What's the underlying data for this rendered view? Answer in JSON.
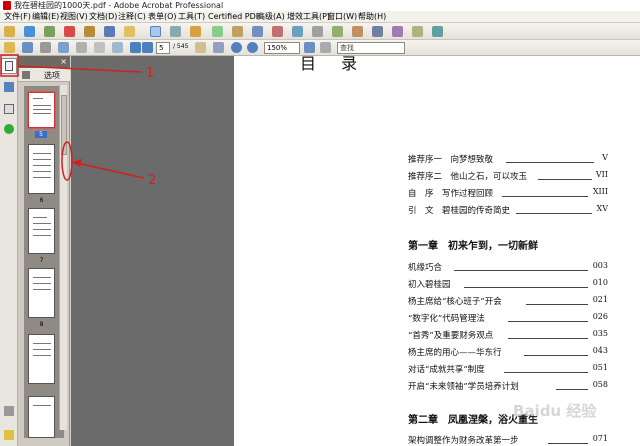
{
  "window": {
    "title": "我在碧桂园的1000天.pdf - Adobe Acrobat Professional"
  },
  "menu": [
    "文件(F)",
    "编辑(E)",
    "视图(V)",
    "文档(D)",
    "注释(C)",
    "表单(O)",
    "工具(T)",
    "Certified PDF",
    "高级(A)",
    "增效工具(P)",
    "窗口(W)",
    "帮助(H)"
  ],
  "toolbar2": {
    "page_current": "5",
    "page_total": "/ 545",
    "zoom": "150%",
    "search_placeholder": "查找"
  },
  "pages_panel": {
    "options_label": "选项",
    "thumb_labels": [
      "5",
      "6",
      "7",
      "8"
    ]
  },
  "annotations": {
    "callout1": "1",
    "callout2": "2"
  },
  "document": {
    "title": "目 录",
    "toc_front": [
      {
        "title": "推荐序一　向梦想致敬",
        "page": "V"
      },
      {
        "title": "推荐序二　他山之石，可以攻玉",
        "page": "VII"
      },
      {
        "title": "自　序　写作过程回顾",
        "page": "XIII"
      },
      {
        "title": "引　文　碧桂园的传奇简史",
        "page": "XV"
      }
    ],
    "chapter1": "第一章　初来乍到，一切新鲜",
    "toc_ch1": [
      {
        "title": "机缘巧合",
        "page": "003"
      },
      {
        "title": "初入碧桂园",
        "page": "010"
      },
      {
        "title": "杨主席给“核心班子”开会",
        "page": "021"
      },
      {
        "title": "“数字化”代码管理法",
        "page": "026"
      },
      {
        "title": "“首秀”及重要财务观点",
        "page": "035"
      },
      {
        "title": "杨主席的用心——华东行",
        "page": "043"
      },
      {
        "title": "对话“成就共享”制度",
        "page": "051"
      },
      {
        "title": "开启“未来领袖”学员培养计划",
        "page": "058"
      }
    ],
    "chapter2": "第二章　凤凰涅槃，浴火重生",
    "toc_ch2": [
      {
        "title": "架构调整作为财务改革第一步",
        "page": "071"
      }
    ]
  },
  "watermark": "Baidu 经验",
  "colors": {
    "accent_red": "#d02020",
    "panel_header": "#6e6a63",
    "doc_bg": "#6b6b6b"
  }
}
